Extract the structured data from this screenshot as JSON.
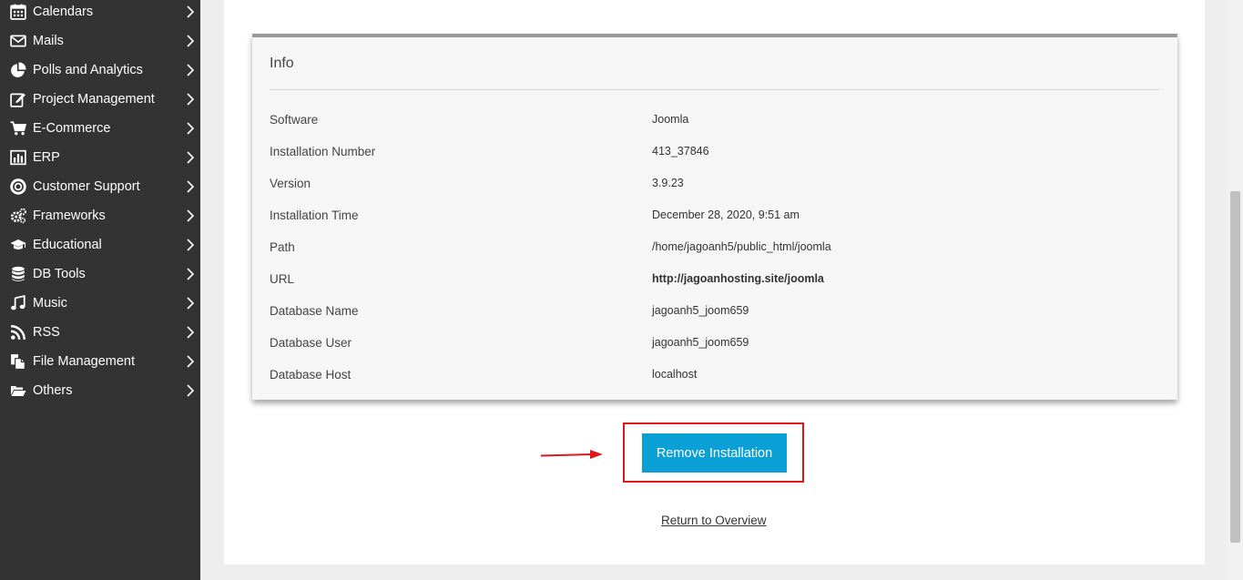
{
  "sidebar": {
    "items": [
      {
        "label": "Calendars",
        "icon": "calendar-icon"
      },
      {
        "label": "Mails",
        "icon": "envelope-icon"
      },
      {
        "label": "Polls and Analytics",
        "icon": "pie-chart-icon"
      },
      {
        "label": "Project Management",
        "icon": "edit-icon"
      },
      {
        "label": "E-Commerce",
        "icon": "cart-icon"
      },
      {
        "label": "ERP",
        "icon": "bar-chart-icon"
      },
      {
        "label": "Customer Support",
        "icon": "lifebuoy-icon"
      },
      {
        "label": "Frameworks",
        "icon": "gears-icon"
      },
      {
        "label": "Educational",
        "icon": "graduation-cap-icon"
      },
      {
        "label": "DB Tools",
        "icon": "database-icon"
      },
      {
        "label": "Music",
        "icon": "music-note-icon"
      },
      {
        "label": "RSS",
        "icon": "rss-icon"
      },
      {
        "label": "File Management",
        "icon": "files-icon"
      },
      {
        "label": "Others",
        "icon": "folder-open-icon"
      }
    ]
  },
  "info": {
    "title": "Info",
    "rows": [
      {
        "key": "Software",
        "value": "Joomla"
      },
      {
        "key": "Installation Number",
        "value": "413_37846"
      },
      {
        "key": "Version",
        "value": "3.9.23"
      },
      {
        "key": "Installation Time",
        "value": "December 28, 2020, 9:51 am"
      },
      {
        "key": "Path",
        "value": "/home/jagoanh5/public_html/joomla"
      },
      {
        "key": "URL",
        "value": "http://jagoanhosting.site/joomla"
      },
      {
        "key": "Database Name",
        "value": "jagoanh5_joom659"
      },
      {
        "key": "Database User",
        "value": "jagoanh5_joom659"
      },
      {
        "key": "Database Host",
        "value": "localhost"
      }
    ]
  },
  "actions": {
    "remove_label": "Remove Installation",
    "return_label": "Return to Overview"
  },
  "colors": {
    "sidebar_bg": "#333333",
    "button_bg": "#0aa0d6",
    "highlight": "#e0161b"
  }
}
